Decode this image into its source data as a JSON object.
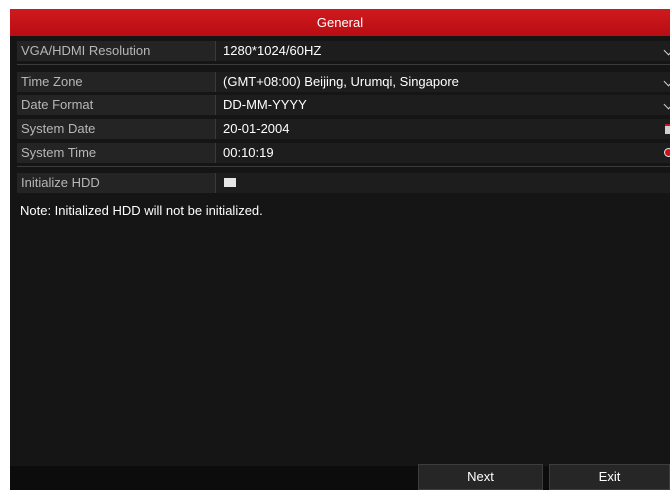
{
  "window": {
    "title": "General"
  },
  "fields": {
    "resolution": {
      "label": "VGA/HDMI Resolution",
      "value": "1280*1024/60HZ",
      "icon": "chevron-down-icon"
    },
    "time_zone": {
      "label": "Time Zone",
      "value": "(GMT+08:00) Beijing, Urumqi, Singapore",
      "icon": "chevron-down-icon"
    },
    "date_format": {
      "label": "Date Format",
      "value": "DD-MM-YYYY",
      "icon": "chevron-down-icon"
    },
    "system_date": {
      "label": "System Date",
      "value": "20-01-2004",
      "icon": "calendar-icon"
    },
    "system_time": {
      "label": "System Time",
      "value": "00:10:19",
      "icon": "clock-icon"
    },
    "initialize_hdd": {
      "label": "Initialize HDD",
      "checked": false
    }
  },
  "note": "Note: Initialized HDD will not be initialized.",
  "buttons": {
    "next": "Next",
    "exit": "Exit"
  },
  "colors": {
    "title_bar": "#c8141a",
    "background": "#151515",
    "text": "#ffffff",
    "label_text": "#b7b7b7"
  }
}
